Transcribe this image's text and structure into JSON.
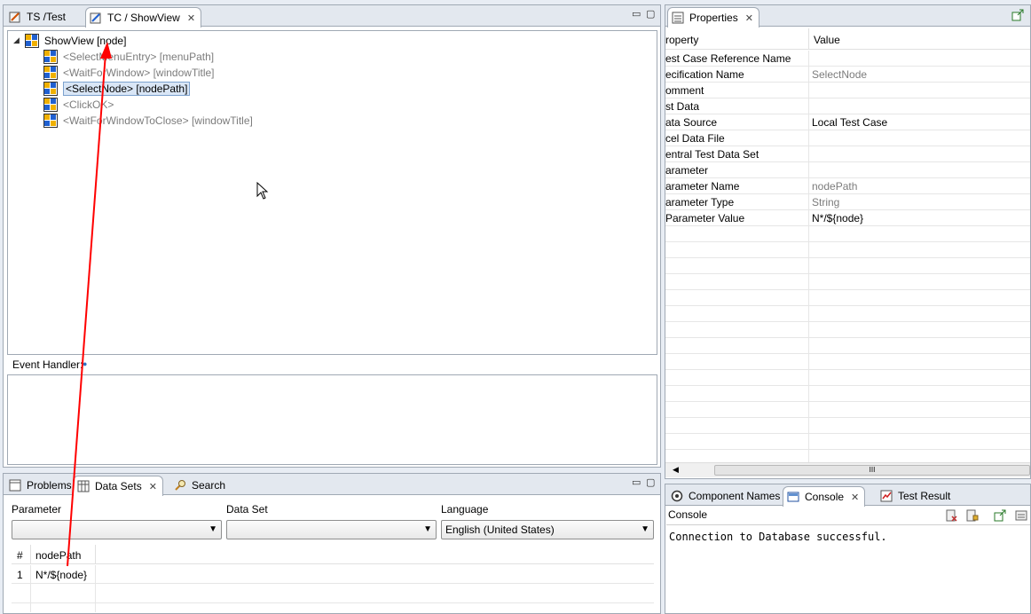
{
  "editor": {
    "tabs": [
      {
        "label": "TS /Test"
      },
      {
        "label": "TC / ShowView"
      }
    ],
    "tree": {
      "root": "ShowView [node]",
      "children": [
        {
          "label": "<SelectMenuEntry> [menuPath]"
        },
        {
          "label": "<WaitForWindow> [windowTitle]"
        },
        {
          "label": "<SelectNode> [nodePath]"
        },
        {
          "label": "<ClickOK>"
        },
        {
          "label": "<WaitForWindowToClose> [windowTitle]"
        }
      ]
    },
    "event_handler_label": "Event Handler:"
  },
  "properties": {
    "title": "Properties",
    "col_property": "roperty",
    "col_value": "Value",
    "rows": [
      {
        "key": "est Case Reference Name",
        "value": ""
      },
      {
        "key": "ecification Name",
        "value": "SelectNode"
      },
      {
        "key": "omment",
        "value": ""
      },
      {
        "key": "st Data",
        "value": ""
      },
      {
        "key": "ata Source",
        "value": "Local Test Case"
      },
      {
        "key": "cel Data File",
        "value": ""
      },
      {
        "key": "entral Test Data Set",
        "value": ""
      },
      {
        "key": "arameter",
        "value": ""
      },
      {
        "key": "arameter Name",
        "value": "nodePath"
      },
      {
        "key": "arameter Type",
        "value": "String"
      },
      {
        "key": "Parameter Value",
        "value": "N*/${node}"
      }
    ],
    "scroll_grip": "III"
  },
  "datasets": {
    "tabs": [
      {
        "label": "Problems"
      },
      {
        "label": "Data Sets"
      },
      {
        "label": "Search"
      }
    ],
    "parameter_label": "Parameter",
    "dataset_label": "Data Set",
    "language_label": "Language",
    "parameter_value": "",
    "dataset_value": "",
    "language_value": "English (United States)",
    "table": {
      "headers": [
        "#",
        "nodePath"
      ],
      "rows": [
        [
          "1",
          "N*/${node}"
        ]
      ]
    }
  },
  "console": {
    "tabs": [
      {
        "label": "Component Names"
      },
      {
        "label": "Console"
      },
      {
        "label": "Test Result"
      }
    ],
    "header": "Console",
    "output": "Connection to Database successful."
  },
  "colors": {
    "annotation_arrow": "#ff0000",
    "selection": "#d9e6f6"
  }
}
